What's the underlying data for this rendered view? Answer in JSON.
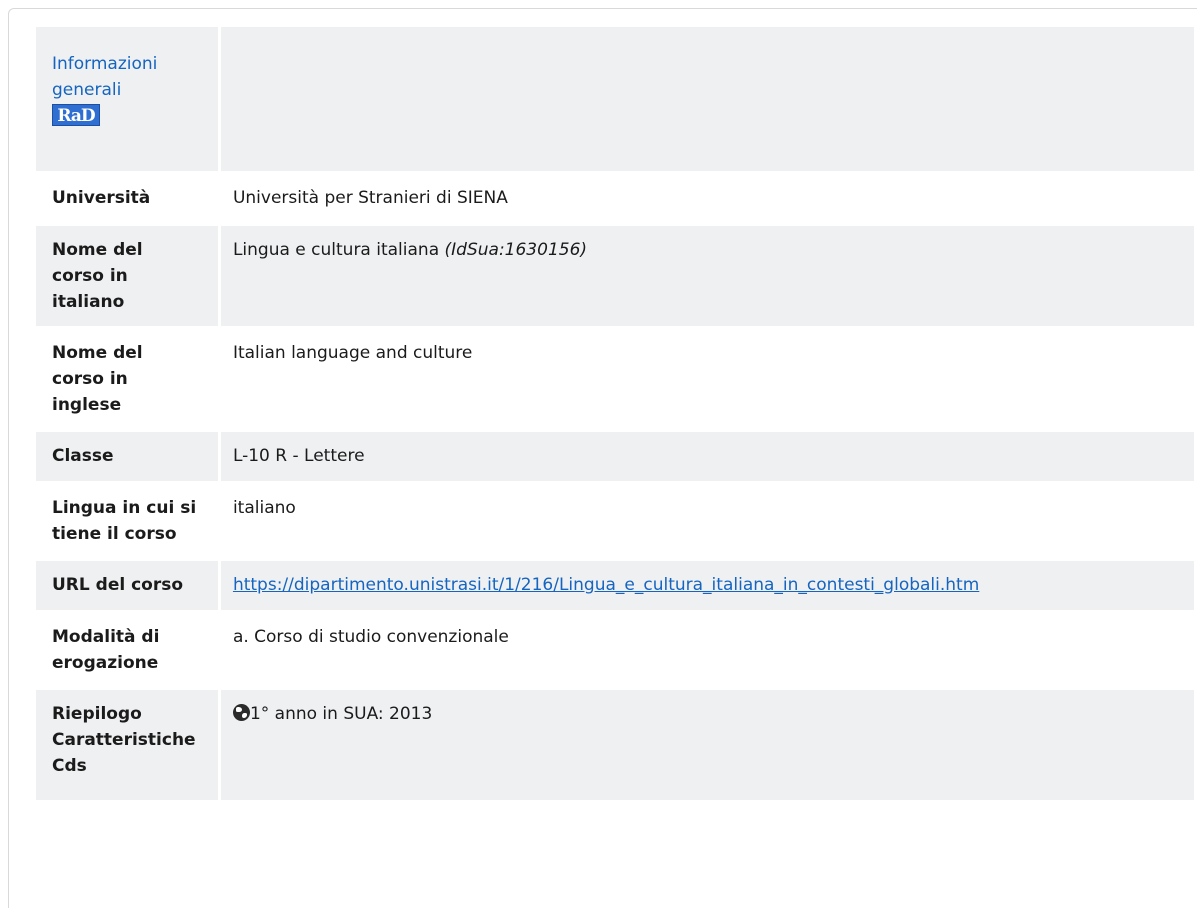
{
  "header": {
    "title": "Informazioni generali",
    "logo_text": "RaD"
  },
  "rows": [
    {
      "label": "Università",
      "value": "Università per Stranieri di SIENA"
    },
    {
      "label": "Nome del corso in italiano",
      "value": "Lingua e cultura italiana",
      "extra": "(IdSua:1630156)"
    },
    {
      "label": "Nome del corso in inglese",
      "value": "Italian language and culture"
    },
    {
      "label": "Classe",
      "value": "L-10 R - Lettere"
    },
    {
      "label": "Lingua in cui si tiene il corso",
      "value": "italiano"
    },
    {
      "label": "URL del corso",
      "value": "https://dipartimento.unistrasi.it/1/216/Lingua_e_cultura_italiana_in_contesti_globali.htm"
    },
    {
      "label": "Modalità di erogazione",
      "value": "a. Corso di studio convenzionale"
    },
    {
      "label": "Riepilogo Caratteristiche Cds",
      "value": "1° anno in SUA: 2013",
      "icon": "globe-icon"
    }
  ],
  "colors": {
    "link": "#1565c0",
    "row_shade": "#eff0f2"
  }
}
